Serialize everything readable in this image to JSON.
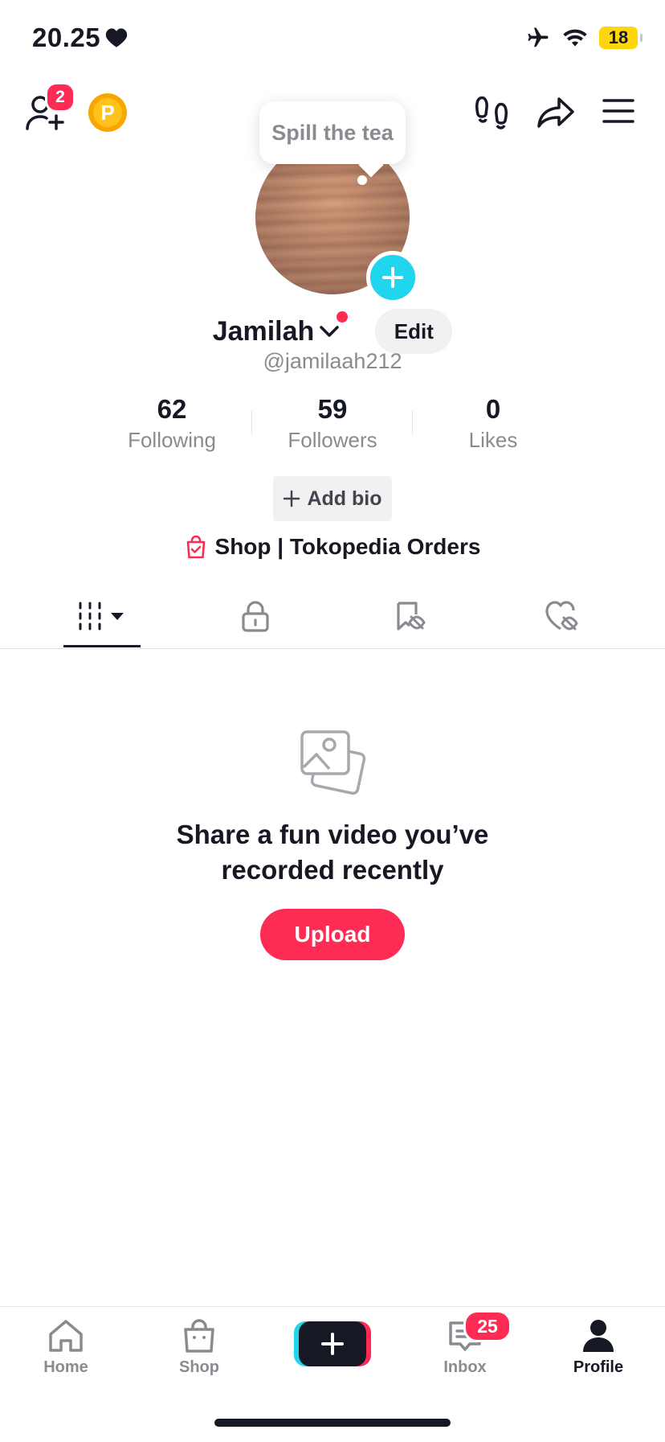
{
  "status_bar": {
    "time": "20.25",
    "battery": "18"
  },
  "header": {
    "friends_badge": "2",
    "points_label": "P"
  },
  "tooltip": {
    "text": "Spill the tea"
  },
  "profile": {
    "display_name": "Jamilah",
    "username": "@jamilaah212",
    "edit_label": "Edit"
  },
  "stats": [
    {
      "value": "62",
      "label": "Following"
    },
    {
      "value": "59",
      "label": "Followers"
    },
    {
      "value": "0",
      "label": "Likes"
    }
  ],
  "add_bio_label": "Add bio",
  "shop_link_label": "Shop | Tokopedia Orders",
  "empty_state": {
    "title_line1": "Share a fun video you’ve",
    "title_line2": "recorded recently",
    "upload_label": "Upload"
  },
  "bottom_nav": {
    "home": "Home",
    "shop": "Shop",
    "inbox": "Inbox",
    "inbox_badge": "25",
    "profile": "Profile"
  },
  "colors": {
    "accent": "#fe2c55",
    "cyan": "#20d5ec",
    "text": "#161823",
    "muted": "#8a8b91",
    "points": "#f7a600"
  }
}
